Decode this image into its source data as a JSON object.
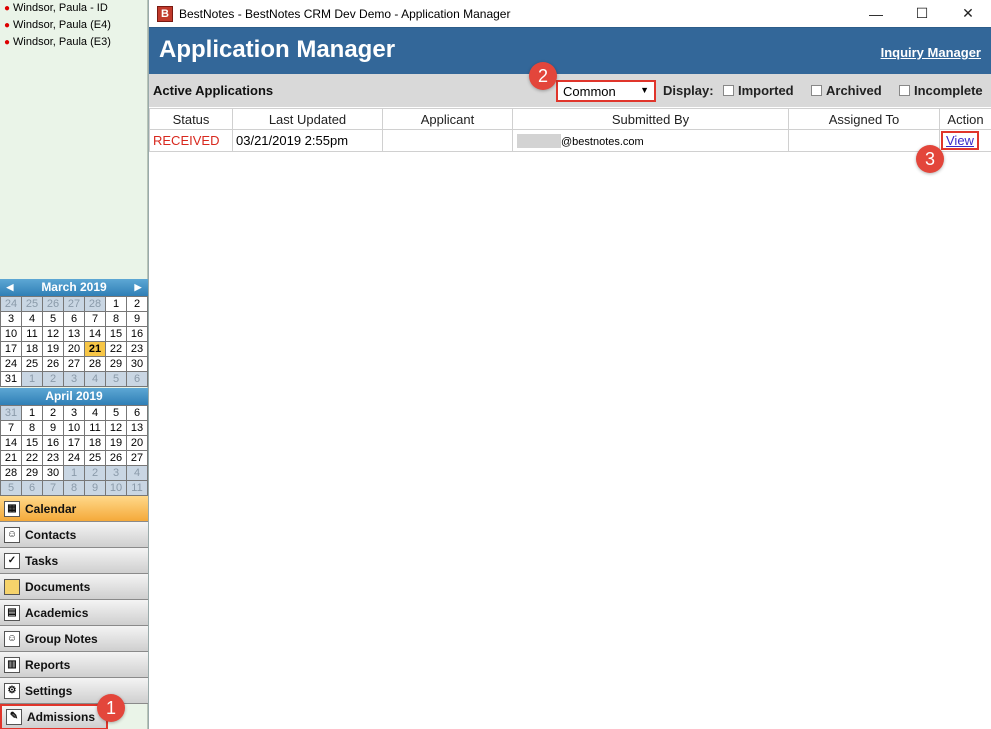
{
  "sidebar": {
    "contacts": [
      "Windsor, Paula - ID",
      "Windsor, Paula (E4)",
      "Windsor, Paula (E3)"
    ],
    "calendar_march": {
      "title": "March 2019",
      "weeks": [
        [
          "24",
          "25",
          "26",
          "27",
          "28",
          "1",
          "2"
        ],
        [
          "3",
          "4",
          "5",
          "6",
          "7",
          "8",
          "9"
        ],
        [
          "10",
          "11",
          "12",
          "13",
          "14",
          "15",
          "16"
        ],
        [
          "17",
          "18",
          "19",
          "20",
          "21",
          "22",
          "23"
        ],
        [
          "24",
          "25",
          "26",
          "27",
          "28",
          "29",
          "30"
        ],
        [
          "31",
          "1",
          "2",
          "3",
          "4",
          "5",
          "6"
        ]
      ],
      "today": "21"
    },
    "calendar_april": {
      "title": "April 2019",
      "weeks": [
        [
          "31",
          "1",
          "2",
          "3",
          "4",
          "5",
          "6"
        ],
        [
          "7",
          "8",
          "9",
          "10",
          "11",
          "12",
          "13"
        ],
        [
          "14",
          "15",
          "16",
          "17",
          "18",
          "19",
          "20"
        ],
        [
          "21",
          "22",
          "23",
          "24",
          "25",
          "26",
          "27"
        ],
        [
          "28",
          "29",
          "30",
          "1",
          "2",
          "3",
          "4"
        ],
        [
          "5",
          "6",
          "7",
          "8",
          "9",
          "10",
          "11"
        ]
      ]
    },
    "nav": [
      {
        "label": "Calendar",
        "icon": "calendar-icon",
        "active": true
      },
      {
        "label": "Contacts",
        "icon": "contacts-icon"
      },
      {
        "label": "Tasks",
        "icon": "tasks-icon"
      },
      {
        "label": "Documents",
        "icon": "folder-icon"
      },
      {
        "label": "Academics",
        "icon": "academics-icon"
      },
      {
        "label": "Group Notes",
        "icon": "group-notes-icon"
      },
      {
        "label": "Reports",
        "icon": "reports-icon"
      },
      {
        "label": "Settings",
        "icon": "settings-icon"
      },
      {
        "label": "Admissions",
        "icon": "admissions-icon",
        "highlighted": true
      }
    ]
  },
  "window": {
    "title": "BestNotes - BestNotes CRM Dev Demo - Application Manager",
    "icon_letter": "B"
  },
  "header": {
    "title": "Application Manager",
    "inquiry_link": "Inquiry Manager"
  },
  "toolbar": {
    "section_label": "Active Applications",
    "select_value": "Common",
    "display_label": "Display:",
    "checkboxes": [
      "Imported",
      "Archived",
      "Incomplete"
    ]
  },
  "table": {
    "columns": [
      "Status",
      "Last Updated",
      "Applicant",
      "Submitted By",
      "Assigned To",
      "Action"
    ],
    "rows": [
      {
        "status": "RECEIVED",
        "last_updated": "03/21/2019 2:55pm",
        "applicant": "",
        "submitted_by": "@bestnotes.com",
        "assigned_to": "",
        "action": "View"
      }
    ]
  },
  "annotations": [
    "1",
    "2",
    "3"
  ],
  "colors": {
    "header_blue": "#336799",
    "status_red": "#d8281e",
    "highlight_red": "#e0352b",
    "badge_red": "#e3463b"
  }
}
